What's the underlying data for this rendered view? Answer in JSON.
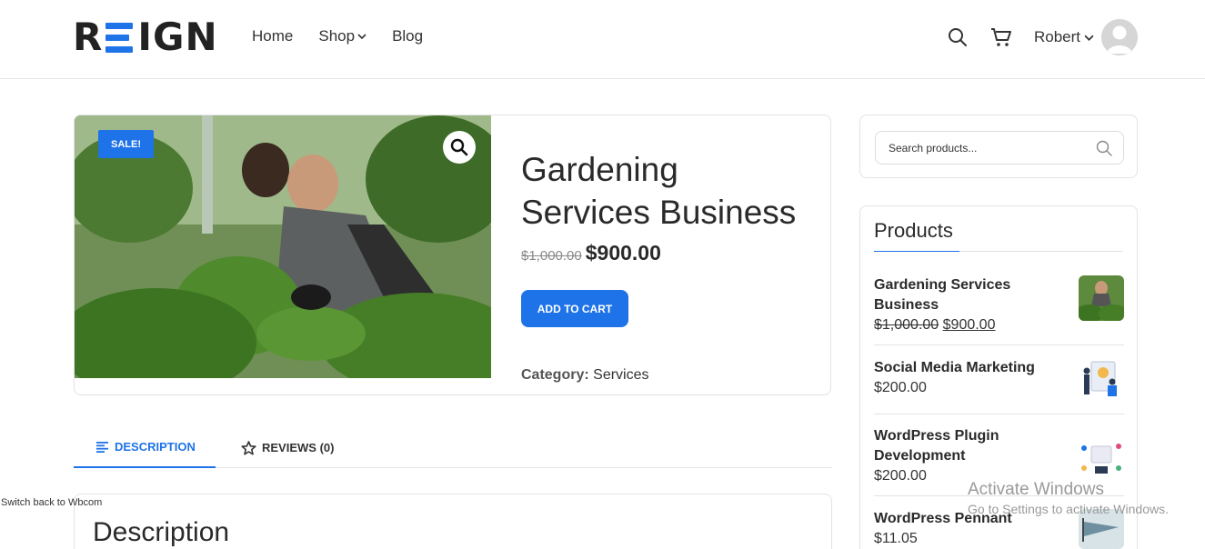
{
  "header": {
    "logo_text": "REIGN",
    "nav": {
      "home": "Home",
      "shop": "Shop",
      "blog": "Blog"
    },
    "user_name": "Robert"
  },
  "product": {
    "sale_badge": "SALE!",
    "title": "Gardening Services Business",
    "price_old": "$1,000.00",
    "price_new": "$900.00",
    "add_to_cart": "ADD TO CART",
    "category_label": "Category:",
    "category_value": "Services"
  },
  "tabs": {
    "description": "DESCRIPTION",
    "reviews": "REVIEWS (0)"
  },
  "description": {
    "heading": "Description"
  },
  "sidebar": {
    "search_placeholder": "Search products...",
    "products_heading": "Products",
    "items": [
      {
        "title": "Gardening Services Business",
        "price_old": "$1,000.00",
        "price_new": "$900.00"
      },
      {
        "title": "Social Media Marketing",
        "price": "$200.00"
      },
      {
        "title": "WordPress Plugin Development",
        "price": "$200.00"
      },
      {
        "title": "WordPress Pennant",
        "price": "$11.05"
      }
    ]
  },
  "footer_link": "Switch back to Wbcom",
  "watermark": {
    "line1": "Activate Windows",
    "line2": "Go to Settings to activate Windows."
  },
  "colors": {
    "accent": "#1e73e8",
    "text": "#2a2a2a",
    "border": "#e3e3e3"
  }
}
